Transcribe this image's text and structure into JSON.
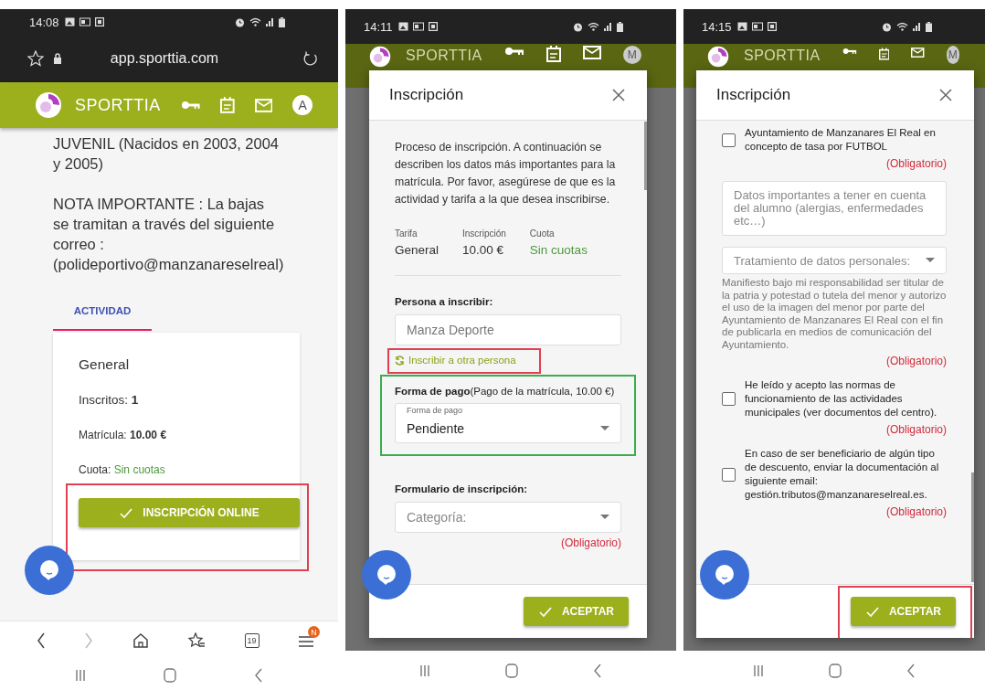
{
  "screens": [
    {
      "kind": "page",
      "time": "14:08",
      "url": "app.sporttia.com",
      "brand": "SPORTTIA",
      "avatar": "A",
      "paragraphs": [
        "JUVENIL (Nacidos en 2003, 2004 y 2005)",
        "NOTA IMPORTANTE : La bajas se tramitan a través del siguiente correo : (polideportivo@manzanareselreal)"
      ],
      "tabs": [
        {
          "label": "ACTIVIDAD",
          "selected": true
        }
      ],
      "card": {
        "title": "General",
        "lines": [
          {
            "label": "Inscritos: ",
            "value": "1",
            "kind": "bold"
          },
          {
            "label": "Matrícula: ",
            "value": "10.00 €",
            "kind": "bold"
          },
          {
            "label": "Cuota: ",
            "value": "Sin cuotas",
            "kind": "positive"
          }
        ],
        "button": {
          "label": "INSCRIPCIÓN ONLINE",
          "color": "#e0404f"
        }
      },
      "tab_count": "19",
      "menu_badge": "N"
    },
    {
      "kind": "dialog",
      "time": "14:11",
      "brand": "SPORTTIA",
      "avatar": "M",
      "title": "Inscripción",
      "items": [
        {
          "kind": "intro",
          "text": "Proceso de inscripción. A continuación se describen los datos más importantes para la matrícula. Por favor, asegúrese de que es la actividad y tarifa a la que desea inscribirse."
        },
        {
          "kind": "summary",
          "columns": [
            {
              "label": "Tarifa",
              "value": "General",
              "kind": "plain"
            },
            {
              "label": "Inscripción",
              "value": "10.00 €",
              "kind": "plain"
            },
            {
              "label": "Cuota",
              "value": "Sin cuotas",
              "kind": "positive"
            }
          ]
        },
        {
          "kind": "person",
          "label": "Persona a inscribir:",
          "value": "Manza Deporte",
          "link": "Inscribir a otra persona",
          "color": "#e0404f"
        },
        {
          "kind": "payment",
          "text": "**Forma de pago**(Pago de la matrícula, 10.00 €)",
          "select_label": "Forma de pago",
          "select_value": "Pendiente",
          "color": "#3aae4c"
        },
        {
          "kind": "form",
          "label": "Formulario de inscripción:",
          "placeholder": "Categoría:",
          "required": "(Obligatorio)"
        }
      ],
      "accept": {
        "label": "ACEPTAR"
      }
    },
    {
      "kind": "dialog",
      "time": "14:15",
      "brand": "SPORTTIA",
      "avatar": "M",
      "title": "Inscripción",
      "items": [
        {
          "kind": "checkbox",
          "text": "Ayuntamiento de Manzanares El Real en concepto de tasa por FUTBOL",
          "checked": false,
          "required": "(Obligatorio)"
        },
        {
          "kind": "textarea",
          "placeholder": "Datos importantes a tener en cuenta del alumno (alergias, enfermedades etc…)"
        },
        {
          "kind": "consent",
          "placeholder": "Tratamiento de datos personales:",
          "description": "Manifiesto bajo mi responsabilidad ser titular de la patria y potestad o tutela del menor y autorizo el uso de la imagen del menor por parte del Ayuntamiento de Manzanares El Real con el fin de publicarla en medios de comunicación del Ayuntamiento.",
          "required": "(Obligatorio)"
        },
        {
          "kind": "checkbox",
          "text": "He leído y acepto las normas de funcionamiento de las actividades municipales (ver documentos del centro).",
          "checked": false,
          "required": "(Obligatorio)"
        },
        {
          "kind": "checkbox",
          "text": "En caso de ser beneficiario de algún tipo de descuento, enviar la documentación al siguiente email: gestión.tributos@manzanareselreal.es.",
          "checked": false,
          "required": "(Obligatorio)"
        }
      ],
      "accept": {
        "label": "ACEPTAR",
        "color": "#e0404f"
      }
    }
  ]
}
